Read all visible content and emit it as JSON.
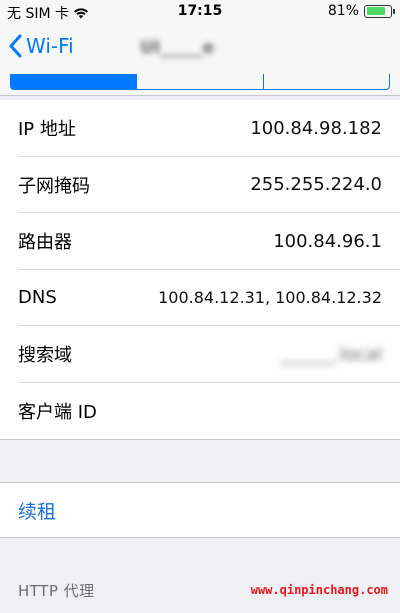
{
  "status_bar": {
    "carrier": "无 SIM 卡",
    "time": "17:15",
    "battery_percent": "81%",
    "battery_level": 0.81,
    "battery_color": "#4cd964",
    "wifi_icon": "wifi-icon"
  },
  "nav": {
    "back_label": "Wi-Fi",
    "back_icon": "chevron-left-icon",
    "title_blurred": "UI_____e"
  },
  "info_rows": [
    {
      "label": "IP 地址",
      "value": "100.84.98.182"
    },
    {
      "label": "子网掩码",
      "value": "255.255.224.0"
    },
    {
      "label": "路由器",
      "value": "100.84.96.1"
    },
    {
      "label": "DNS",
      "value": "100.84.12.31, 100.84.12.32"
    },
    {
      "label": "搜索域",
      "value": "______.local"
    },
    {
      "label": "客户端 ID",
      "value": ""
    }
  ],
  "renew": {
    "label": "续租"
  },
  "proxy": {
    "header": "HTTP 代理"
  },
  "watermark": "www.qinpinchang.com",
  "colors": {
    "accent": "#007aff",
    "link": "#1a73d8",
    "watermark": "#e81919"
  }
}
